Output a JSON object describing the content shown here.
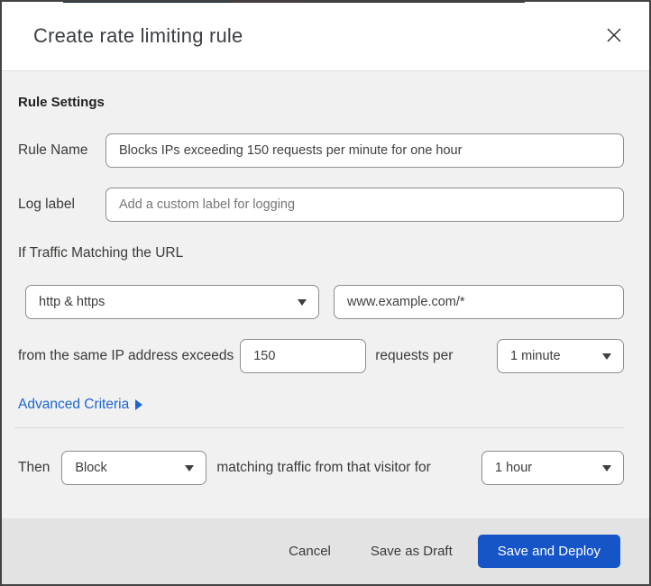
{
  "dialog": {
    "title": "Create rate limiting rule"
  },
  "rule_settings": {
    "heading": "Rule Settings",
    "rule_name": {
      "label": "Rule Name",
      "value": "Blocks IPs exceeding 150 requests per minute for one hour"
    },
    "log_label": {
      "label": "Log label",
      "placeholder": "Add a custom label for logging"
    }
  },
  "traffic_match": {
    "heading": "If Traffic Matching the URL",
    "scheme_select": {
      "value": "http & https"
    },
    "url_input": {
      "value": "www.example.com/*"
    },
    "threshold_text_before": "from the same IP address exceeds",
    "threshold_input": {
      "value": "150"
    },
    "threshold_text_after": "requests per",
    "period_select": {
      "value": "1 minute"
    },
    "advanced_link_label": "Advanced Criteria"
  },
  "action": {
    "then_label": "Then",
    "action_select": {
      "value": "Block"
    },
    "matching_text": "matching traffic from that visitor for",
    "duration_select": {
      "value": "1 hour"
    }
  },
  "footer": {
    "cancel_label": "Cancel",
    "save_draft_label": "Save as Draft",
    "save_deploy_label": "Save and Deploy"
  },
  "colors": {
    "primary_button_blue": "#1655c8",
    "link_blue": "#1b66cf",
    "body_background": "#f1f1f1",
    "footer_background": "#e3e3e4",
    "header_background": "#ffffff",
    "input_border": "#8e8e8e"
  }
}
